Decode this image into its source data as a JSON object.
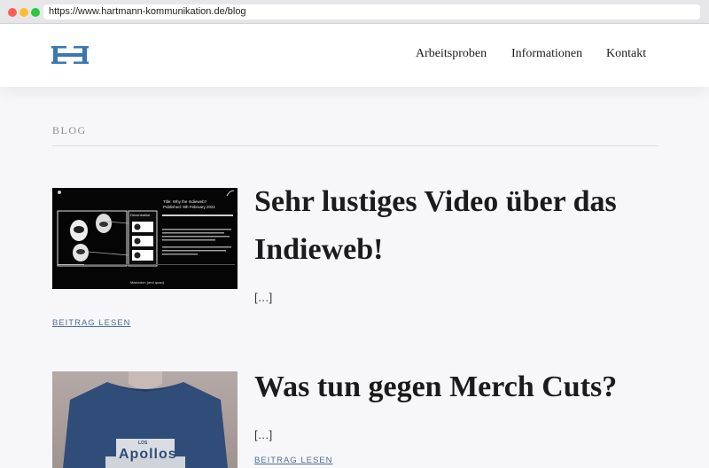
{
  "browser": {
    "url": "https://www.hartmann-kommunikation.de/blog"
  },
  "brand": {
    "logo_text": "H",
    "accent": "#3a77b3"
  },
  "nav": {
    "items": [
      "Arbeitsproben",
      "Informationen",
      "Kontakt"
    ]
  },
  "blog": {
    "label": "BLOG",
    "posts": [
      {
        "title": "Sehr lustiges Video über das Indieweb!",
        "excerpt": "[…]",
        "read_more": "BEITRAG LESEN",
        "thumb": {
          "info_lines": [
            "Title: Why the Indieweb?",
            "Published: 9th February 2021"
          ],
          "side_title": "Decentralise",
          "caption": "Mastodon (and quan)"
        }
      },
      {
        "title": "Was tun gegen Merch Cuts?",
        "excerpt": "[…]",
        "read_more": "BEITRAG LESEN",
        "thumb": {
          "shirt_small": "LOS",
          "shirt_text": "Apollos"
        }
      }
    ]
  }
}
